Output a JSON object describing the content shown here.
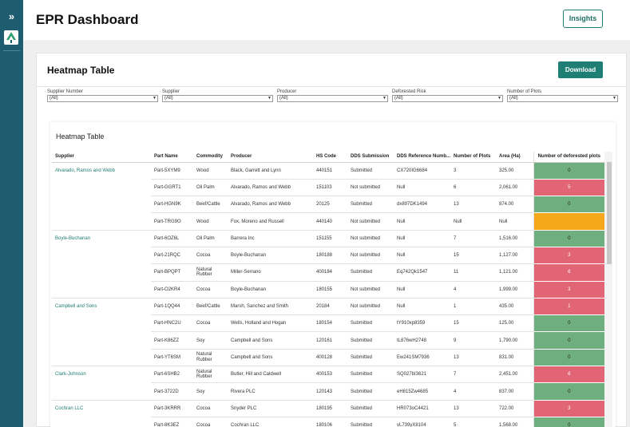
{
  "app": {
    "title": "EPR Dashboard",
    "insights_label": "Insights"
  },
  "panel": {
    "title": "Heatmap Table",
    "download_label": "Download"
  },
  "filters": [
    {
      "label": "Supplier Number",
      "value": "(All)"
    },
    {
      "label": "Supplier",
      "value": "(All)"
    },
    {
      "label": "Producer",
      "value": "(All)"
    },
    {
      "label": "Deforested Risk",
      "value": "(All)"
    },
    {
      "label": "Number of Plots",
      "value": "(All)"
    }
  ],
  "table": {
    "title": "Heatmap Table",
    "columns": [
      "Supplier",
      "Part Name",
      "Commodity",
      "Producer",
      "HS Code",
      "DDS Submission",
      "DDS Reference Numb...",
      "Number of Plots",
      "Area (Ha)",
      "Number of deforested plots"
    ],
    "rows": [
      {
        "supplier": "Alvarado, Ramos and Webb",
        "part": "Part-5XYM9",
        "commodity": "Wood",
        "producer": "Black, Garrett and Lynn",
        "hs": "440151",
        "dds": "Submitted",
        "ref": "CX720IG6684",
        "plots": "3",
        "area": "325.00",
        "deforested": "0",
        "level": "low"
      },
      {
        "supplier": "",
        "part": "Part-GGRT1",
        "commodity": "Oil Palm",
        "producer": "Alvarado, Ramos and Webb",
        "hs": "151103",
        "dds": "Not submitted",
        "ref": "Null",
        "plots": "6",
        "area": "2,061.00",
        "deforested": "5",
        "level": "high"
      },
      {
        "supplier": "",
        "part": "Part-HGN9K",
        "commodity": "Beef/Cattle",
        "producer": "Alvarado, Ramos and Webb",
        "hs": "20125",
        "dds": "Submitted",
        "ref": "dx897DK1494",
        "plots": "13",
        "area": "874.00",
        "deforested": "0",
        "level": "low"
      },
      {
        "supplier": "",
        "part": "Part-TRG9O",
        "commodity": "Wood",
        "producer": "Fox, Moreno and Russell",
        "hs": "440140",
        "dds": "Not submitted",
        "ref": "Null",
        "plots": "Null",
        "area": "Null",
        "deforested": "",
        "level": "null"
      },
      {
        "supplier": "Boyle-Buchanan",
        "part": "Part-6OZ6L",
        "commodity": "Oil Palm",
        "producer": "Barrera Inc",
        "hs": "151155",
        "dds": "Not submitted",
        "ref": "Null",
        "plots": "7",
        "area": "1,516.00",
        "deforested": "0",
        "level": "low"
      },
      {
        "supplier": "",
        "part": "Part-21RQC",
        "commodity": "Cocoa",
        "producer": "Boyle-Buchanan",
        "hs": "180188",
        "dds": "Not submitted",
        "ref": "Null",
        "plots": "15",
        "area": "1,127.00",
        "deforested": "3",
        "level": "high"
      },
      {
        "supplier": "",
        "part": "Part-BPQPT",
        "commodity": "Natural Rubber",
        "producer": "Miller-Serrano",
        "hs": "400184",
        "dds": "Submitted",
        "ref": "Eq742Qk1547",
        "plots": "11",
        "area": "1,121.00",
        "deforested": "6",
        "level": "high"
      },
      {
        "supplier": "",
        "part": "Part-O2KR4",
        "commodity": "Cocoa",
        "producer": "Boyle-Buchanan",
        "hs": "180155",
        "dds": "Not submitted",
        "ref": "Null",
        "plots": "4",
        "area": "1,999.00",
        "deforested": "3",
        "level": "high"
      },
      {
        "supplier": "Campbell and Sons",
        "part": "Part-1QQ44",
        "commodity": "Beef/Cattle",
        "producer": "Marsh, Sanchez and Smith",
        "hs": "20184",
        "dds": "Not submitted",
        "ref": "Null",
        "plots": "1",
        "area": "435.00",
        "deforested": "1",
        "level": "high"
      },
      {
        "supplier": "",
        "part": "Part-HNC2U",
        "commodity": "Cocoa",
        "producer": "Wells, Holland and Hogan",
        "hs": "180154",
        "dds": "Submitted",
        "ref": "tY910xp8359",
        "plots": "15",
        "area": "125.00",
        "deforested": "0",
        "level": "low"
      },
      {
        "supplier": "",
        "part": "Part-K86ZZ",
        "commodity": "Soy",
        "producer": "Campbell and Sons",
        "hs": "120161",
        "dds": "Submitted",
        "ref": "tL876wH2748",
        "plots": "9",
        "area": "1,790.00",
        "deforested": "0",
        "level": "low"
      },
      {
        "supplier": "",
        "part": "Part-YT6SM",
        "commodity": "Natural Rubber",
        "producer": "Campbell and Sons",
        "hs": "400128",
        "dds": "Submitted",
        "ref": "Ew241SM7936",
        "plots": "13",
        "area": "831.00",
        "deforested": "0",
        "level": "low"
      },
      {
        "supplier": "Clark-Johnson",
        "part": "Part-6SHB2",
        "commodity": "Natural Rubber",
        "producer": "Butler, Hill and Caldwell",
        "hs": "400153",
        "dds": "Submitted",
        "ref": "SQ027bI3621",
        "plots": "7",
        "area": "2,451.00",
        "deforested": "6",
        "level": "high"
      },
      {
        "supplier": "",
        "part": "Part-3722D",
        "commodity": "Soy",
        "producer": "Rivera PLC",
        "hs": "120143",
        "dds": "Submitted",
        "ref": "eH815Zw4685",
        "plots": "4",
        "area": "837.00",
        "deforested": "0",
        "level": "low"
      },
      {
        "supplier": "Cochran LLC",
        "part": "Part-3KRRR",
        "commodity": "Cocoa",
        "producer": "Snyder PLC",
        "hs": "180195",
        "dds": "Submitted",
        "ref": "HR073oC4421",
        "plots": "13",
        "area": "722.00",
        "deforested": "3",
        "level": "high"
      },
      {
        "supplier": "",
        "part": "Part-8K3EZ",
        "commodity": "Cocoa",
        "producer": "Cochran LLC",
        "hs": "180106",
        "dds": "Submitted",
        "ref": "vL739yX8104",
        "plots": "5",
        "area": "1,568.00",
        "deforested": "0",
        "level": "low"
      }
    ]
  },
  "colors": {
    "rail": "#1e5d70",
    "accent": "#1f7f74",
    "heat_low": "#6fae7e",
    "heat_high": "#e26575",
    "heat_null": "#f6a81a"
  },
  "icons": {
    "expand": "double-chevron-right-icon",
    "logo": "app-logo-icon",
    "dropdown": "caret-down-icon"
  }
}
